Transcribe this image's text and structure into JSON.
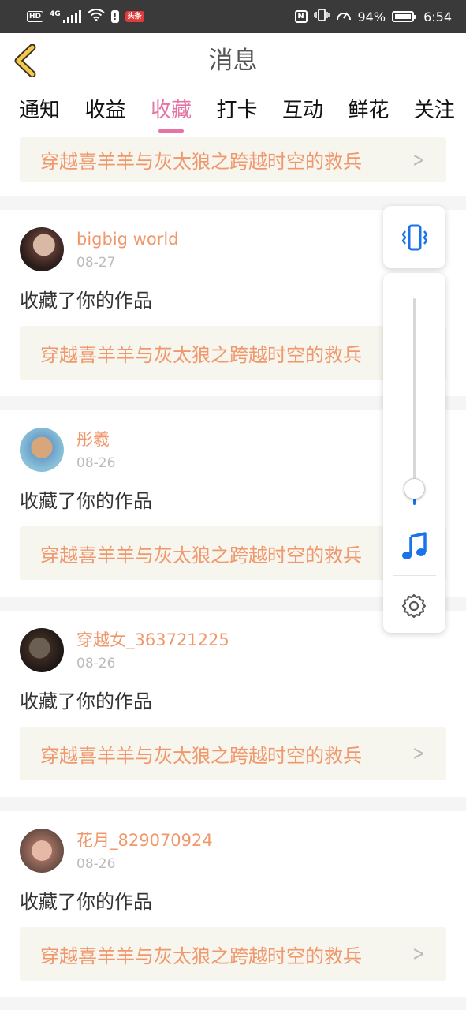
{
  "status_bar": {
    "left_badges": [
      "HD",
      "4G"
    ],
    "app_badge": "头条",
    "battery": "94%",
    "time": "6:54",
    "icons": [
      "hd-icon",
      "signal-icon",
      "wifi-icon",
      "warning-icon",
      "toutiao-icon",
      "nfc-icon",
      "vibrate-icon",
      "speed-icon",
      "battery-icon"
    ]
  },
  "nav": {
    "title": "消息",
    "back_icon": "chevron-left-icon",
    "accent": "#f3c94a"
  },
  "tabs": [
    {
      "label": "通知",
      "active": false
    },
    {
      "label": "收益",
      "active": false
    },
    {
      "label": "收藏",
      "active": true
    },
    {
      "label": "打卡",
      "active": false
    },
    {
      "label": "互动",
      "active": false
    },
    {
      "label": "鲜花",
      "active": false
    },
    {
      "label": "关注",
      "active": false
    }
  ],
  "top_strip": {
    "work_title": "穿越喜羊羊与灰太狼之跨越时空的救兵"
  },
  "cards": [
    {
      "user": "bigbig world",
      "date": "08-27",
      "action": "收藏了你的作品",
      "work_title": "穿越喜羊羊与灰太狼之跨越时空的救兵"
    },
    {
      "user": "彤羲",
      "date": "08-26",
      "action": "收藏了你的作品",
      "work_title": "穿越喜羊羊与灰太狼之跨越时空的救兵"
    },
    {
      "user": "穿越女_363721225",
      "date": "08-26",
      "action": "收藏了你的作品",
      "work_title": "穿越喜羊羊与灰太狼之跨越时空的救兵"
    },
    {
      "user": "花月_829070924",
      "date": "08-26",
      "action": "收藏了你的作品",
      "work_title": "穿越喜羊羊与灰太狼之跨越时空的救兵"
    }
  ],
  "volume_panel": {
    "level": 0.05,
    "icons": [
      "vibrate-icon",
      "music-note-icon",
      "gear-icon"
    ],
    "accent": "#1a73e8"
  },
  "colors": {
    "tab_active": "#e573a4",
    "user_name": "#f0986c",
    "work_title": "#f0986c",
    "work_bg": "#f6f5ee"
  }
}
